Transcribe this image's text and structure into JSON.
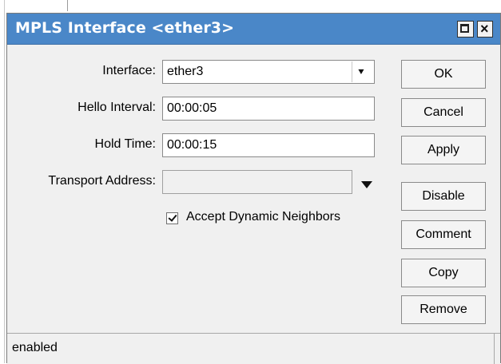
{
  "window": {
    "title": "MPLS Interface <ether3>",
    "accent_color": "#4a87c8"
  },
  "form": {
    "interface": {
      "label": "Interface:",
      "value": "ether3"
    },
    "hello_interval": {
      "label": "Hello Interval:",
      "value": "00:00:05"
    },
    "hold_time": {
      "label": "Hold Time:",
      "value": "00:00:15"
    },
    "transport_address": {
      "label": "Transport Address:",
      "value": ""
    },
    "accept_dynamic_neighbors": {
      "label": "Accept Dynamic Neighbors",
      "checked": true
    }
  },
  "buttons": {
    "ok": "OK",
    "cancel": "Cancel",
    "apply": "Apply",
    "disable": "Disable",
    "comment": "Comment",
    "copy": "Copy",
    "remove": "Remove"
  },
  "status": {
    "text": "enabled"
  },
  "icons": {
    "maximize": "maximize-icon",
    "close": "close-icon",
    "interface_dropdown": "dropdown-icon",
    "transport_dropdown": "chevron-down-icon"
  }
}
